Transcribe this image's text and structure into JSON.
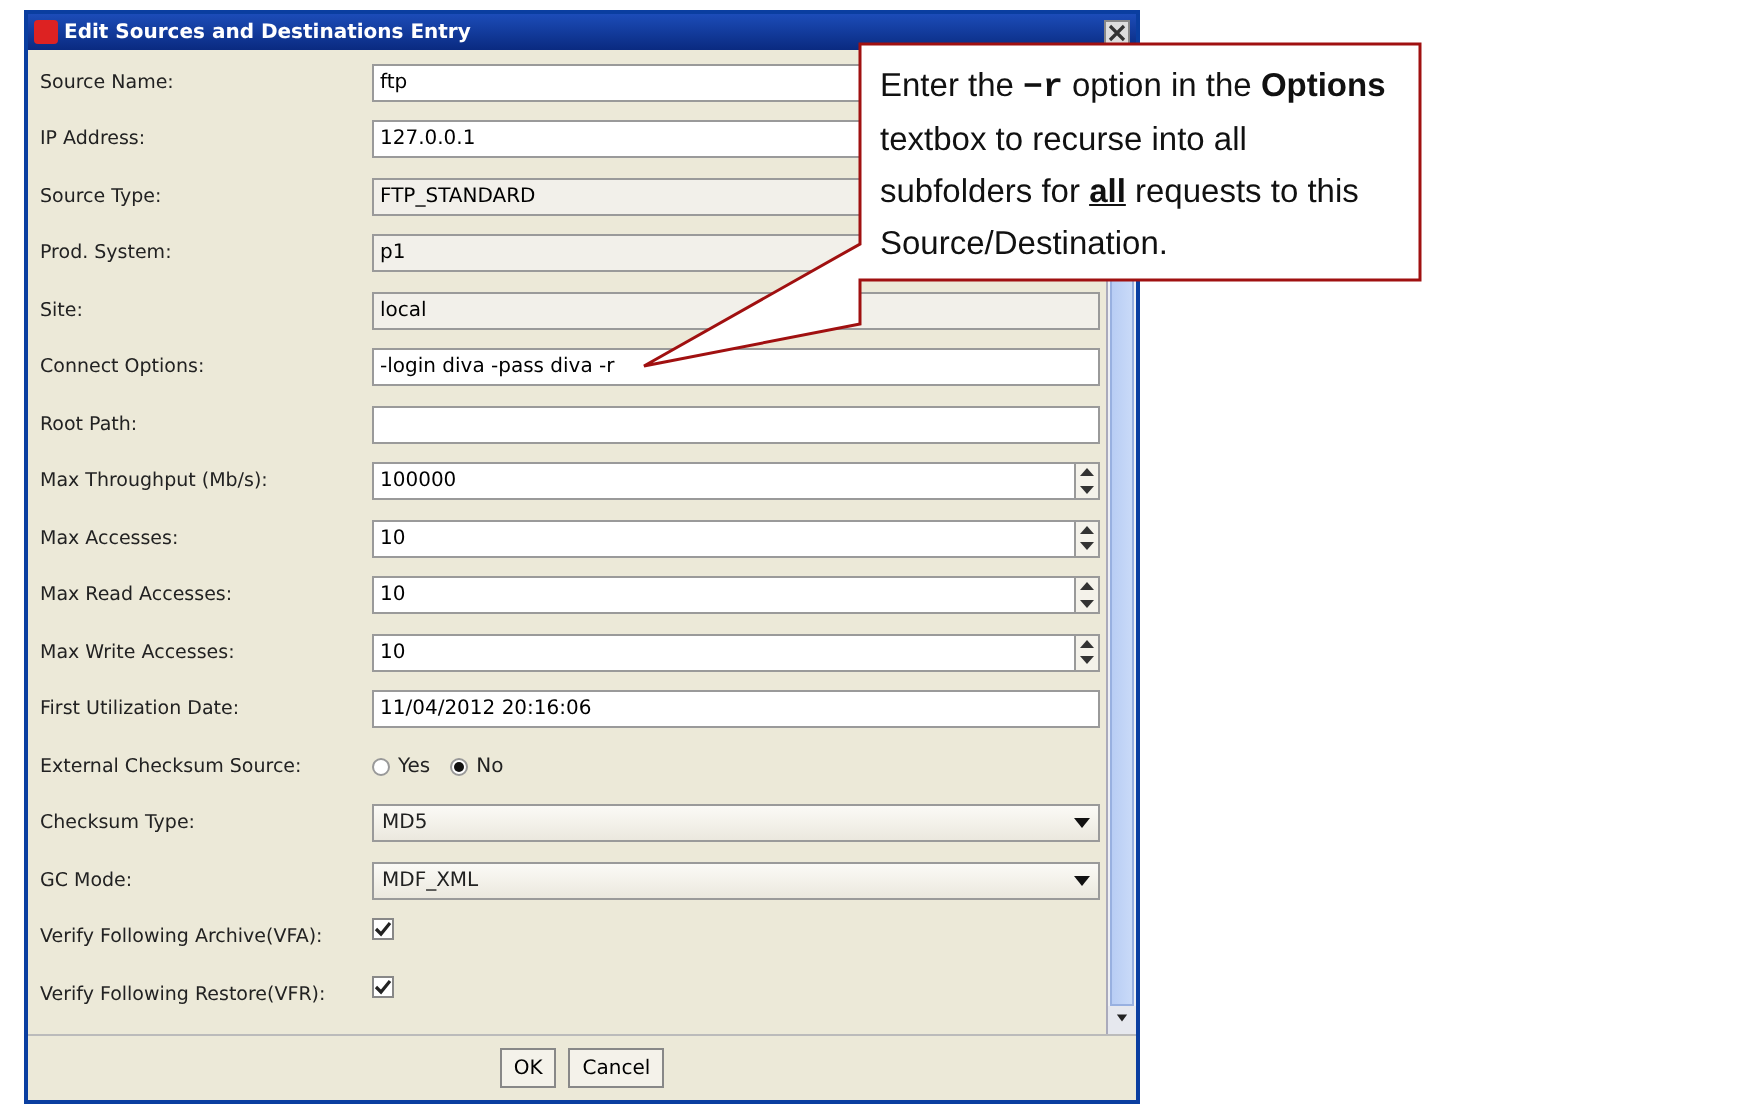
{
  "window": {
    "title": "Edit Sources and Destinations Entry"
  },
  "fields": [
    {
      "label": "Source Name:",
      "kind": "text",
      "value": "ftp"
    },
    {
      "label": "IP Address:",
      "kind": "text",
      "value": "127.0.0.1"
    },
    {
      "label": "Source Type:",
      "kind": "readonly",
      "value": "FTP_STANDARD"
    },
    {
      "label": "Prod. System:",
      "kind": "readonly",
      "value": "p1"
    },
    {
      "label": "Site:",
      "kind": "readonly",
      "value": "local"
    },
    {
      "label": "Connect Options:",
      "kind": "text",
      "value": "-login diva -pass diva -r"
    },
    {
      "label": "Root Path:",
      "kind": "text"
    },
    {
      "label": "Max Throughput (Mb/s):",
      "kind": "spinner",
      "value": "100000"
    },
    {
      "label": "Max Accesses:",
      "kind": "spinner",
      "value": "10"
    },
    {
      "label": "Max Read Accesses:",
      "kind": "spinner",
      "value": "10"
    },
    {
      "label": "Max Write Accesses:",
      "kind": "spinner",
      "value": "10"
    },
    {
      "label": "First Utilization Date:",
      "kind": "text",
      "value": "11/04/2012 20:16:06"
    },
    {
      "label": "External Checksum Source:",
      "kind": "radio",
      "options": [
        {
          "label": "Yes",
          "selected": false
        },
        {
          "label": "No",
          "selected": true
        }
      ]
    },
    {
      "label": "Checksum Type:",
      "kind": "combo",
      "value": "MD5"
    },
    {
      "label": "GC Mode:",
      "kind": "combo",
      "value": "MDF_XML"
    },
    {
      "label": "Verify Following Archive(VFA):",
      "kind": "checkbox",
      "checked": true
    },
    {
      "label": "Verify Following Restore(VFR):",
      "kind": "checkbox",
      "checked": true
    }
  ],
  "buttons": [
    "OK",
    "Cancel"
  ],
  "callout": {
    "text": "Enter the **−r** option in the **Options** textbox to recurse into all subfolders for **all** requests to this Source/Destination."
  }
}
